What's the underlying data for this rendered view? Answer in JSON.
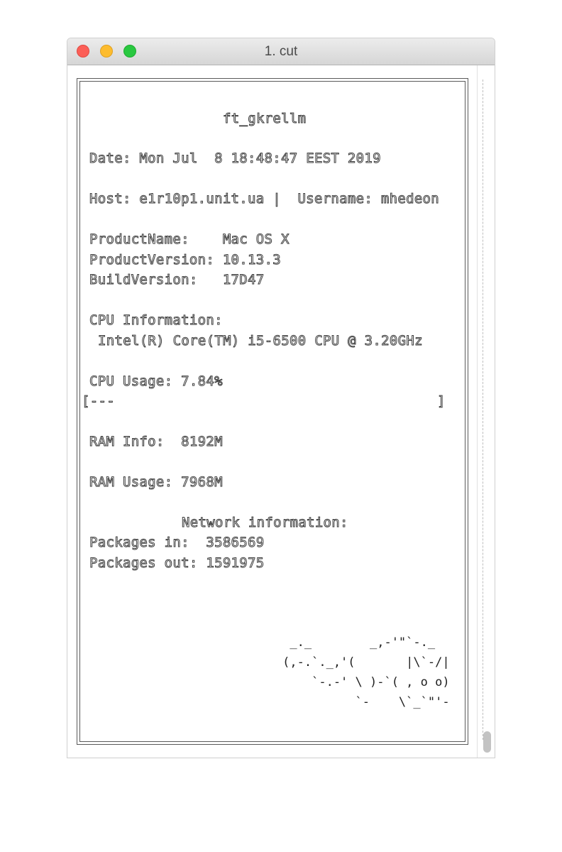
{
  "window": {
    "title": "1. cut"
  },
  "terminal": {
    "app_name": "ft_gkrellm",
    "date_line": "Date: Mon Jul  8 18:48:47 EEST 2019",
    "host_line": "Host: e1r10p1.unit.ua |  Username: mhedeon",
    "product_name_line": "ProductName:    Mac OS X",
    "product_version_line": "ProductVersion: 10.13.3",
    "build_version_line": "BuildVersion:   17D47",
    "cpu_info_header": "CPU Information:",
    "cpu_model": "Intel(R) Core(TM) i5-6500 CPU @ 3.20GHz",
    "cpu_usage_line": "CPU Usage: 7.84%",
    "cpu_usage_percent": 7.84,
    "cpu_bar_open": "[---",
    "cpu_bar_close": "]",
    "ram_info_line": "RAM Info:  8192M",
    "ram_usage_line": "RAM Usage: 7968M",
    "network_header": "Network information:",
    "packages_in_line": "Packages in:  3586569",
    "packages_out_line": "Packages out: 1591975",
    "ascii_art": "      _._        _,-'\"`-._\n     (,-.`._,'(       |\\`-/|\n         `-.-' \\ )-`( , o o)\n               `-    \\`_`\"'-"
  },
  "colors": {
    "close": "#fc5f57",
    "minimize": "#fdbc2e",
    "maximize": "#29c840"
  }
}
